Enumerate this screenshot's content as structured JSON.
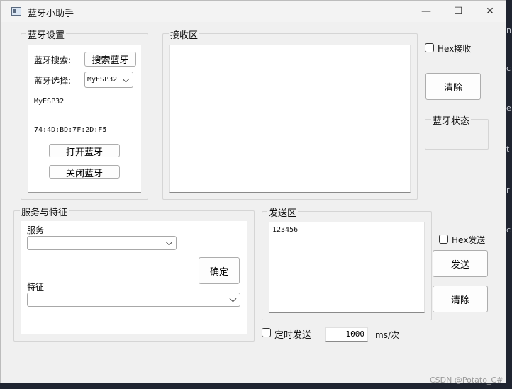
{
  "window": {
    "title": "蓝牙小助手",
    "minimize": "—",
    "maximize": "☐",
    "close": "✕"
  },
  "bt_settings": {
    "group_title": "蓝牙设置",
    "search_label": "蓝牙搜索:",
    "search_button": "搜索蓝牙",
    "select_label": "蓝牙选择:",
    "selected_device": "MyESP32",
    "device_name": "MyESP32",
    "device_mac": "74:4D:BD:7F:2D:F5",
    "open_button": "打开蓝牙",
    "close_button": "关闭蓝牙"
  },
  "receive": {
    "group_title": "接收区",
    "content": ""
  },
  "right": {
    "hex_receive": "Hex接收",
    "hex_receive_checked": false,
    "clear_button": "清除",
    "status_group_title": "蓝牙状态"
  },
  "services": {
    "group_title": "服务与特征",
    "service_label": "服务",
    "service_value": "",
    "confirm_button": "确定",
    "characteristic_label": "特征",
    "characteristic_value": ""
  },
  "send": {
    "group_title": "发送区",
    "content": "123456",
    "hex_send": "Hex发送",
    "hex_send_checked": false,
    "send_button": "发送",
    "clear_button": "清除",
    "timed_send": "定时发送",
    "timed_send_checked": false,
    "interval_value": "1000",
    "interval_unit": "ms/次"
  },
  "background": {
    "watermark": "CSDN @Potato_C#"
  },
  "colors": {
    "window_bg": "#f0f0f0",
    "panel_bg": "#ffffff",
    "desktop_bg": "#1f2430"
  }
}
